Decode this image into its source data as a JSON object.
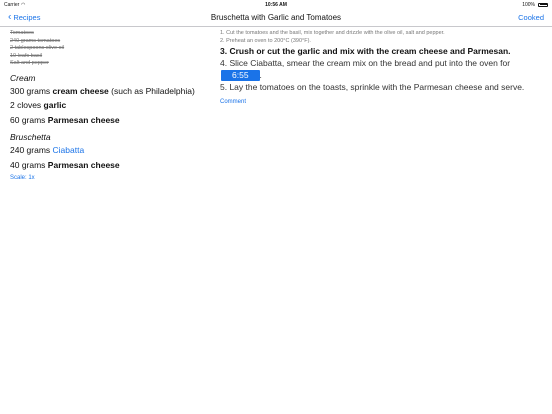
{
  "status_bar": {
    "carrier": "Carrier",
    "wifi_icon": "wifi-icon",
    "time": "10:56 AM",
    "battery": "100%"
  },
  "nav": {
    "back_label": "Recipes",
    "title": "Bruschetta with Garlic and Tomatoes",
    "action_label": "Cooked"
  },
  "checked_ingredients": [
    "Tomatoes",
    "240 grams tomatoes",
    "2 tablespoons olive oil",
    "10 leafs basil",
    "Salt and pepper"
  ],
  "groups": [
    {
      "title": "Cream",
      "items": [
        {
          "qty": "300 grams ",
          "name": "cream cheese",
          "suffix": " (such as Philadelphia)"
        },
        {
          "qty": "2 cloves ",
          "name": "garlic",
          "suffix": ""
        },
        {
          "qty": "60 grams ",
          "name": "Parmesan cheese",
          "suffix": ""
        }
      ]
    },
    {
      "title": "Bruschetta",
      "items": [
        {
          "qty": "240 grams ",
          "link": "Ciabatta"
        },
        {
          "qty": "40 grams ",
          "name": "Parmesan cheese",
          "suffix": ""
        }
      ]
    }
  ],
  "scale_label": "Scale: 1x",
  "steps": {
    "s1": "1. Cut the tomatoes and the basil, mix together and drizzle with the olive oil, salt and pepper.",
    "s2": "2. Preheat an oven to 200°C (390°F).",
    "s3": "3. Crush or cut the garlic and mix with the cream cheese and Parmesan.",
    "s4_text": "4. Slice Ciabatta, smear the cream mix on the bread and put into the oven for",
    "s4_timer": "6:55",
    "s4_end": ".",
    "s5": "5. Lay the tomatoes on the toasts, sprinkle with the Parmesan cheese and serve."
  },
  "comment_label": "Comment",
  "colors": {
    "accent": "#1a73e8"
  }
}
